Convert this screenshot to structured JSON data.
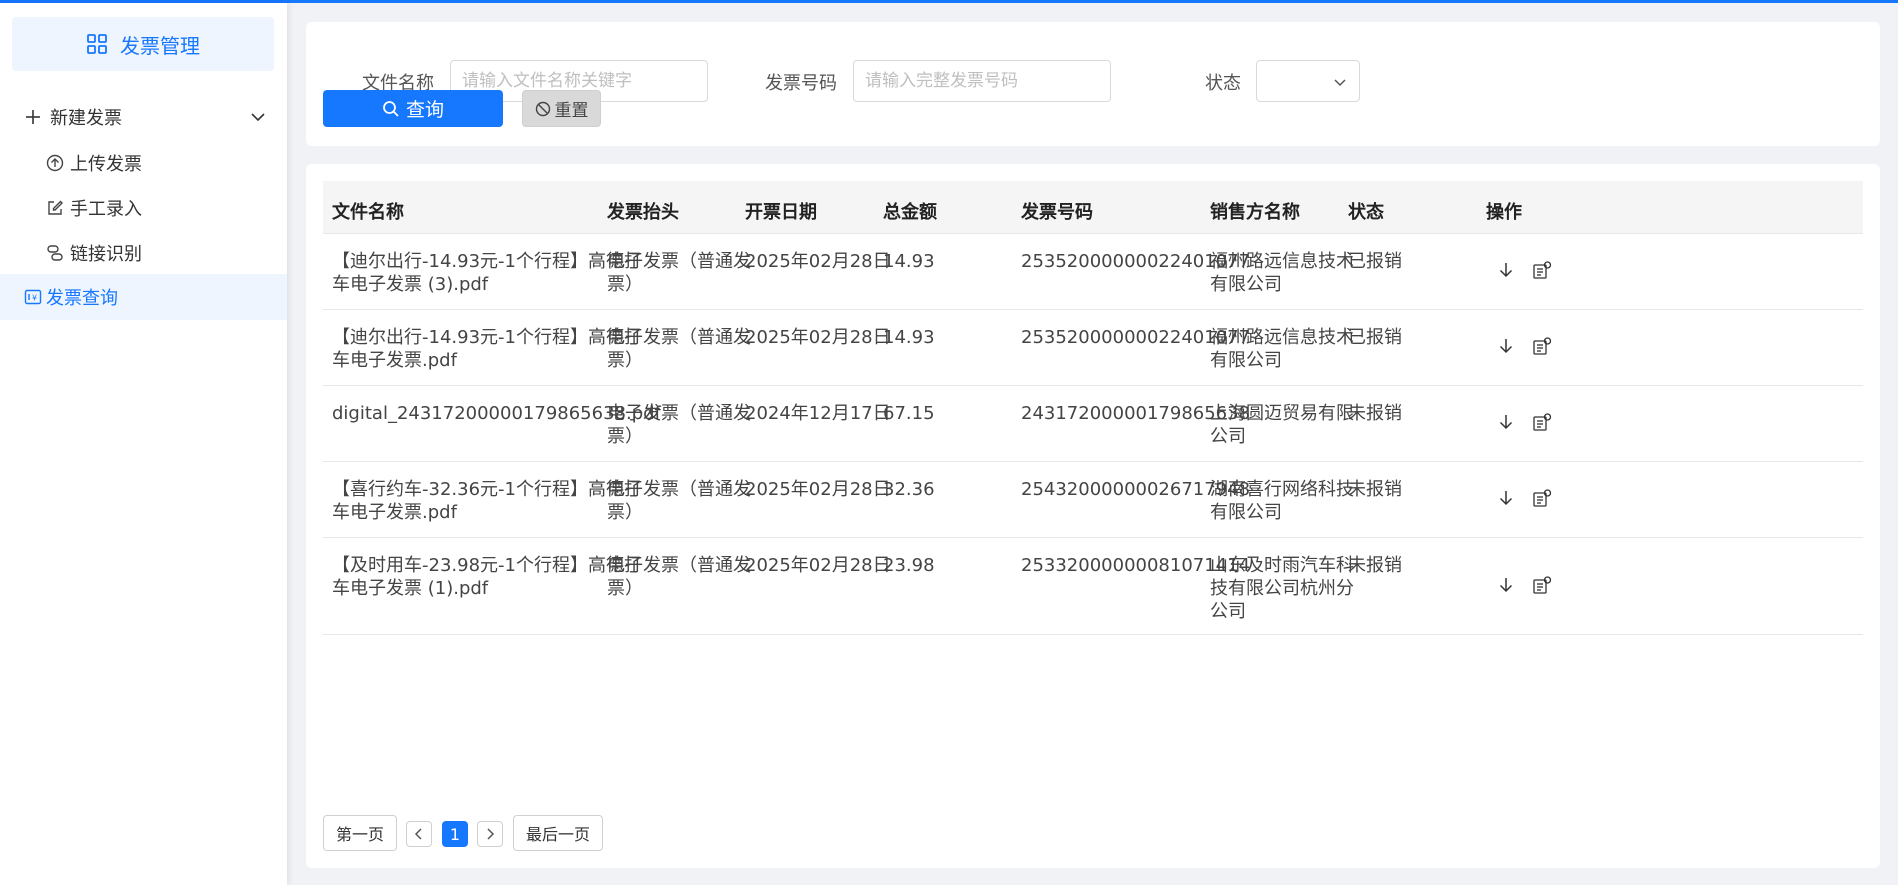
{
  "sidebar": {
    "brand": "发票管理",
    "new_invoice": "新建发票",
    "sub_items": [
      "上传发票",
      "手工录入",
      "链接识别"
    ],
    "invoice_query": "发票查询"
  },
  "search": {
    "filename_label": "文件名称",
    "filename_placeholder": "请输入文件名称关键字",
    "number_label": "发票号码",
    "number_placeholder": "请输入完整发票号码",
    "status_label": "状态",
    "status_value": "",
    "query_button": "查询",
    "reset_button": "重置"
  },
  "table": {
    "columns": [
      "文件名称",
      "发票抬头",
      "开票日期",
      "总金额",
      "发票号码",
      "销售方名称",
      "状态",
      "操作"
    ],
    "rows": [
      {
        "filename": "【迪尔出行-14.93元-1个行程】高德打车电子发票 (3).pdf",
        "title": "电子发票（普通发票）",
        "date": "2025年02月28日",
        "amount": "14.93",
        "number": "25352000000022401077",
        "seller": "福州路远信息技术有限公司",
        "status": "已报销"
      },
      {
        "filename": "【迪尔出行-14.93元-1个行程】高德打车电子发票.pdf",
        "title": "电子发票（普通发票）",
        "date": "2025年02月28日",
        "amount": "14.93",
        "number": "25352000000022401077",
        "seller": "福州路远信息技术有限公司",
        "status": "已报销"
      },
      {
        "filename": "digital_24317200000179865638.pdf",
        "title": "电子发票（普通发票）",
        "date": "2024年12月17日",
        "amount": "67.15",
        "number": "24317200000179865638",
        "seller": "上海圆迈贸易有限公司",
        "status": "未报销"
      },
      {
        "filename": "【喜行约车-32.36元-1个行程】高德打车电子发票.pdf",
        "title": "电子发票（普通发票）",
        "date": "2025年02月28日",
        "amount": "32.36",
        "number": "25432000000026717948",
        "seller": "湖南喜行网络科技有限公司",
        "status": "未报销"
      },
      {
        "filename": "【及时用车-23.98元-1个行程】高德打车电子发票 (1).pdf",
        "title": "电子发票（普通发票）",
        "date": "2025年02月28日",
        "amount": "23.98",
        "number": "25332000000081071414",
        "seller": "山东及时雨汽车科技有限公司杭州分公司",
        "status": "未报销"
      }
    ]
  },
  "pagination": {
    "first": "第一页",
    "current": "1",
    "last": "最后一页"
  },
  "colors": {
    "accent": "#1677ff"
  }
}
